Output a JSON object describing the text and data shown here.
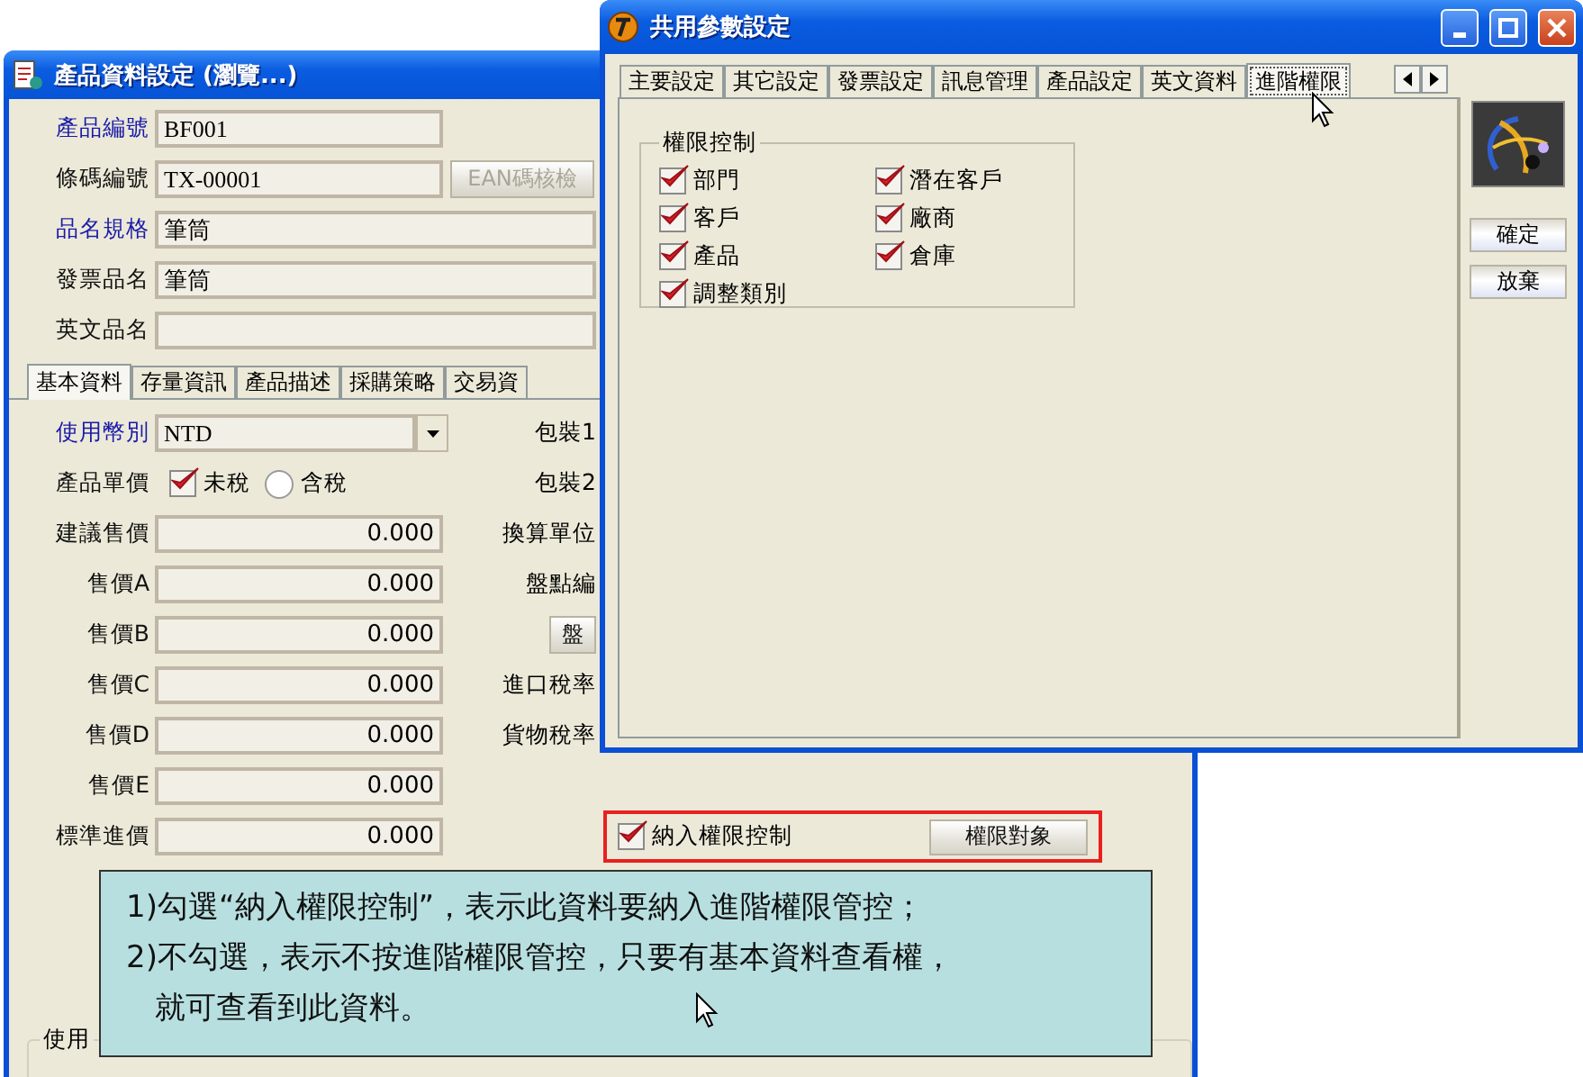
{
  "back_window": {
    "title": "產品資料設定 (瀏覽...)",
    "fields": [
      {
        "label": "產品編號",
        "value": "BF001",
        "emphasis": true,
        "kind": "short"
      },
      {
        "label": "條碼編號",
        "value": "TX-00001",
        "emphasis": false,
        "kind": "short"
      },
      {
        "label": "品名規格",
        "value": "筆筒",
        "emphasis": true,
        "kind": "long"
      },
      {
        "label": "發票品名",
        "value": "筆筒",
        "emphasis": false,
        "kind": "long"
      },
      {
        "label": "英文品名",
        "emphasis": false,
        "kind": "long"
      }
    ],
    "ean_button": {
      "label": "EAN碼核檢",
      "disabled": true
    },
    "tabs": [
      {
        "label": "基本資料",
        "selected": true
      },
      {
        "label": "存量資訊",
        "selected": false
      },
      {
        "label": "產品描述",
        "selected": false
      },
      {
        "label": "採購策略",
        "selected": false
      },
      {
        "label": "交易資",
        "selected": false
      }
    ],
    "currency": {
      "label": "使用幣別",
      "value": "NTD"
    },
    "unit_price": {
      "label": "產品單價",
      "options": [
        {
          "label": "未稅",
          "selected": true
        },
        {
          "label": "含稅",
          "selected": false
        }
      ]
    },
    "prices": [
      {
        "label": "建議售價",
        "value": "0.000"
      },
      {
        "label": "售價A",
        "value": "0.000"
      },
      {
        "label": "售價B",
        "value": "0.000"
      },
      {
        "label": "售價C",
        "value": "0.000"
      },
      {
        "label": "售價D",
        "value": "0.000"
      },
      {
        "label": "售價E",
        "value": "0.000"
      },
      {
        "label": "標準進價",
        "value": "0.000"
      }
    ],
    "right_items": [
      {
        "kind": "label",
        "text": "包裝1"
      },
      {
        "kind": "label",
        "text": "包裝2"
      },
      {
        "kind": "label",
        "text": "換算單位"
      },
      {
        "kind": "label",
        "text": "盤點編"
      },
      {
        "kind": "button",
        "text": "盤"
      },
      {
        "kind": "label",
        "text": "進口稅率"
      },
      {
        "kind": "label",
        "text": "貨物稅率"
      }
    ],
    "permission": {
      "label": "納入權限控制",
      "checked": true,
      "button": "權限對象"
    },
    "group_label": "使用"
  },
  "front_window": {
    "title": "共用參數設定",
    "tabs": [
      {
        "label": "主要設定",
        "selected": false
      },
      {
        "label": "其它設定",
        "selected": false
      },
      {
        "label": "發票設定",
        "selected": false
      },
      {
        "label": "訊息管理",
        "selected": false
      },
      {
        "label": "產品設定",
        "selected": false
      },
      {
        "label": "英文資料",
        "selected": false
      },
      {
        "label": "進階權限",
        "selected": true
      }
    ],
    "group_label": "權限控制",
    "permissions": [
      {
        "label": "部門",
        "checked": true
      },
      {
        "label": "客戶",
        "checked": true
      },
      {
        "label": "產品",
        "checked": true
      },
      {
        "label": "調整類別",
        "checked": true
      },
      {
        "label": "潛在客戶",
        "checked": true
      },
      {
        "label": "廠商",
        "checked": true
      },
      {
        "label": "倉庫",
        "checked": true
      }
    ],
    "buttons": [
      "確定",
      "放棄"
    ]
  },
  "callout": {
    "lines": [
      "1)勾選“納入權限控制”，表示此資料要納入進階權限管控；",
      "2)不勾選，表示不按進階權限管控，只要有基本資料查看權，",
      "就可查看到此資料。"
    ]
  }
}
